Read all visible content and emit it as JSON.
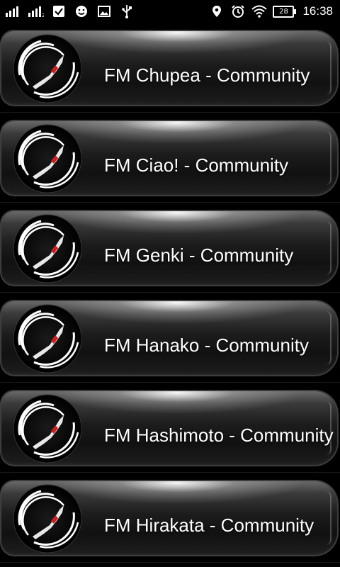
{
  "status_bar": {
    "time": "16:38",
    "battery": "28",
    "left_icons": [
      "signal-icon",
      "signal-2-icon",
      "image-check-icon",
      "smiley-icon",
      "picture-icon",
      "usb-icon"
    ],
    "right_icons": [
      "location-icon",
      "alarm-icon",
      "wifi-icon",
      "battery-icon"
    ]
  },
  "colors": {
    "background": "#000000",
    "text": "#ffffff",
    "logo_red": "#d01c1c"
  },
  "stations": [
    {
      "name": "FM Chupea - Community"
    },
    {
      "name": "FM Ciao! - Community"
    },
    {
      "name": "FM Genki - Community"
    },
    {
      "name": "FM Hanako - Community"
    },
    {
      "name": "FM Hashimoto - Community"
    },
    {
      "name": "FM Hirakata - Community"
    }
  ]
}
